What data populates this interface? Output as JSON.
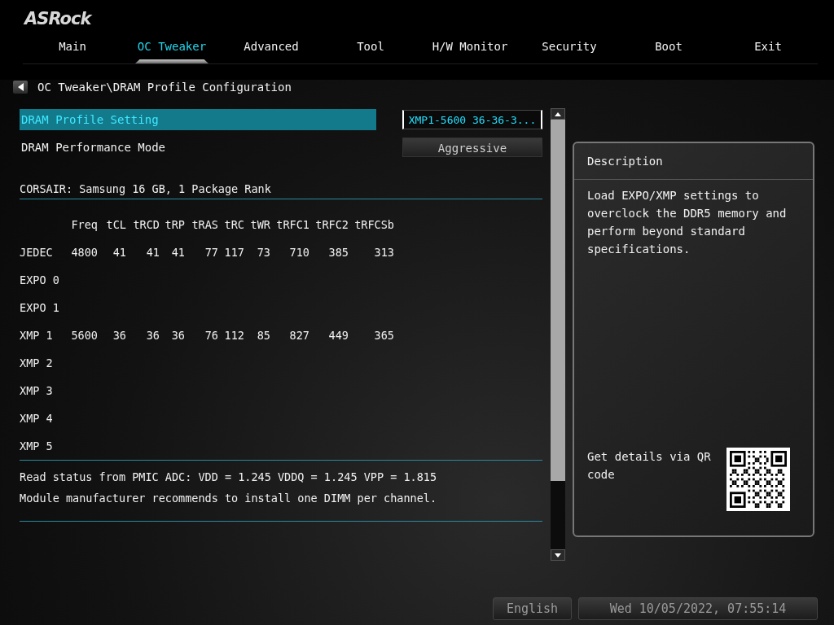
{
  "logo": "ASRock",
  "tabs": [
    {
      "label": "Main",
      "selected": false
    },
    {
      "label": "OC Tweaker",
      "selected": true
    },
    {
      "label": "Advanced",
      "selected": false
    },
    {
      "label": "Tool",
      "selected": false
    },
    {
      "label": "H/W Monitor",
      "selected": false
    },
    {
      "label": "Security",
      "selected": false
    },
    {
      "label": "Boot",
      "selected": false
    },
    {
      "label": "Exit",
      "selected": false
    }
  ],
  "breadcrumb": "OC Tweaker\\DRAM Profile Configuration",
  "settings": [
    {
      "label": "DRAM Profile Setting",
      "value": "XMP1-5600 36-36-3...",
      "selected": true
    },
    {
      "label": "DRAM Performance Mode",
      "value": "Aggressive",
      "selected": false
    }
  ],
  "module_info": "CORSAIR: Samsung 16 GB, 1 Package Rank",
  "timing_table": {
    "columns": [
      "Freq",
      "tCL",
      "tRCD",
      "tRP",
      "tRAS",
      "tRC",
      "tWR",
      "tRFC1",
      "tRFC2",
      "tRFCSb"
    ],
    "rows": [
      {
        "label": "JEDEC",
        "values": [
          "4800",
          "41",
          "41",
          "41",
          "77",
          "117",
          "73",
          "710",
          "385",
          "313"
        ]
      },
      {
        "label": "EXPO 0"
      },
      {
        "label": "EXPO 1"
      },
      {
        "label": "XMP 1",
        "values": [
          "5600",
          "36",
          "36",
          "36",
          "76",
          "112",
          "85",
          "827",
          "449",
          "365"
        ]
      },
      {
        "label": "XMP 2"
      },
      {
        "label": "XMP 3"
      },
      {
        "label": "XMP 4"
      },
      {
        "label": "XMP 5"
      }
    ]
  },
  "status_lines": [
    "Read status from PMIC ADC: VDD = 1.245 VDDQ = 1.245 VPP = 1.815",
    "Module manufacturer recommends to install one DIMM per channel."
  ],
  "description": {
    "title": "Description",
    "text": "Load EXPO/XMP settings to overclock the DDR5 memory and perform beyond standard specifications.",
    "qr_text": "Get details via QR code"
  },
  "footer": {
    "language": "English",
    "datetime": "Wed 10/05/2022, 07:55:14"
  }
}
